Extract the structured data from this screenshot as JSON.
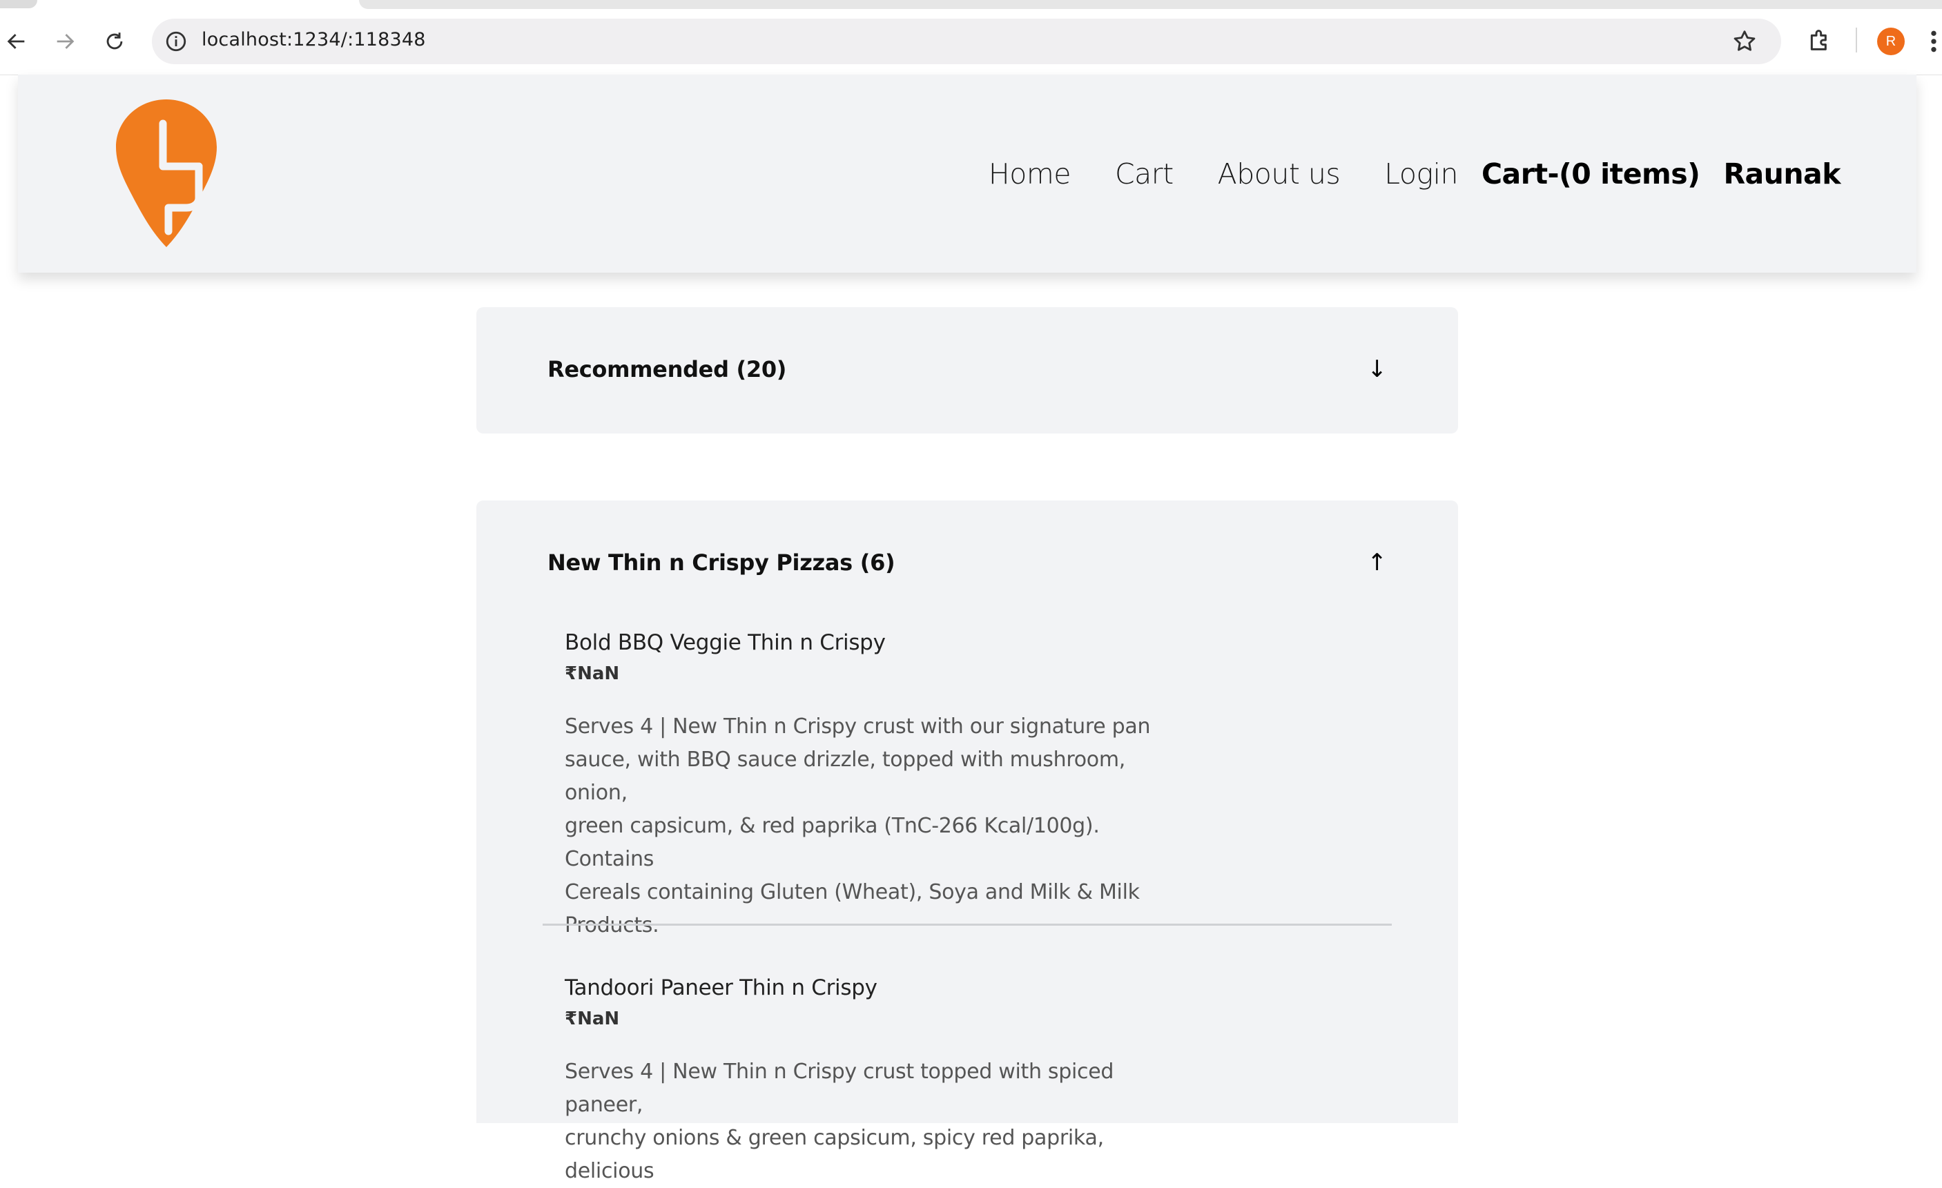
{
  "browser": {
    "url": "localhost:1234/:118348",
    "avatar_letter": "R",
    "accent": "#ef6c1a"
  },
  "header": {
    "logo": "swiggy-logo",
    "nav": [
      "Home",
      "Cart",
      "About us",
      "Login"
    ],
    "cart_summary": "Cart-(0 items)",
    "user_name": "Raunak",
    "brand_color": "#f07c1e"
  },
  "menu": {
    "categories": [
      {
        "title": "Recommended (20)",
        "arrow": "↓",
        "expanded": false
      },
      {
        "title": "New Thin n Crispy Pizzas (6)",
        "arrow": "↑",
        "expanded": true,
        "items": [
          {
            "name": "Bold BBQ Veggie Thin n Crispy",
            "price": "₹NaN",
            "description_lines": [
              "Serves 4 | New Thin n Crispy crust with our signature pan",
              "sauce, with BBQ sauce drizzle, topped with mushroom, onion,",
              "green capsicum, & red paprika (TnC-266 Kcal/100g). Contains",
              "Cereals containing Gluten (Wheat), Soya and Milk & Milk",
              "Products."
            ]
          },
          {
            "name": "Tandoori Paneer Thin n Crispy",
            "price": "₹NaN",
            "description_lines": [
              "Serves 4 | New Thin n Crispy crust topped with spiced paneer,",
              "crunchy onions & green capsicum, spicy red paprika, delicious"
            ]
          }
        ]
      }
    ]
  }
}
